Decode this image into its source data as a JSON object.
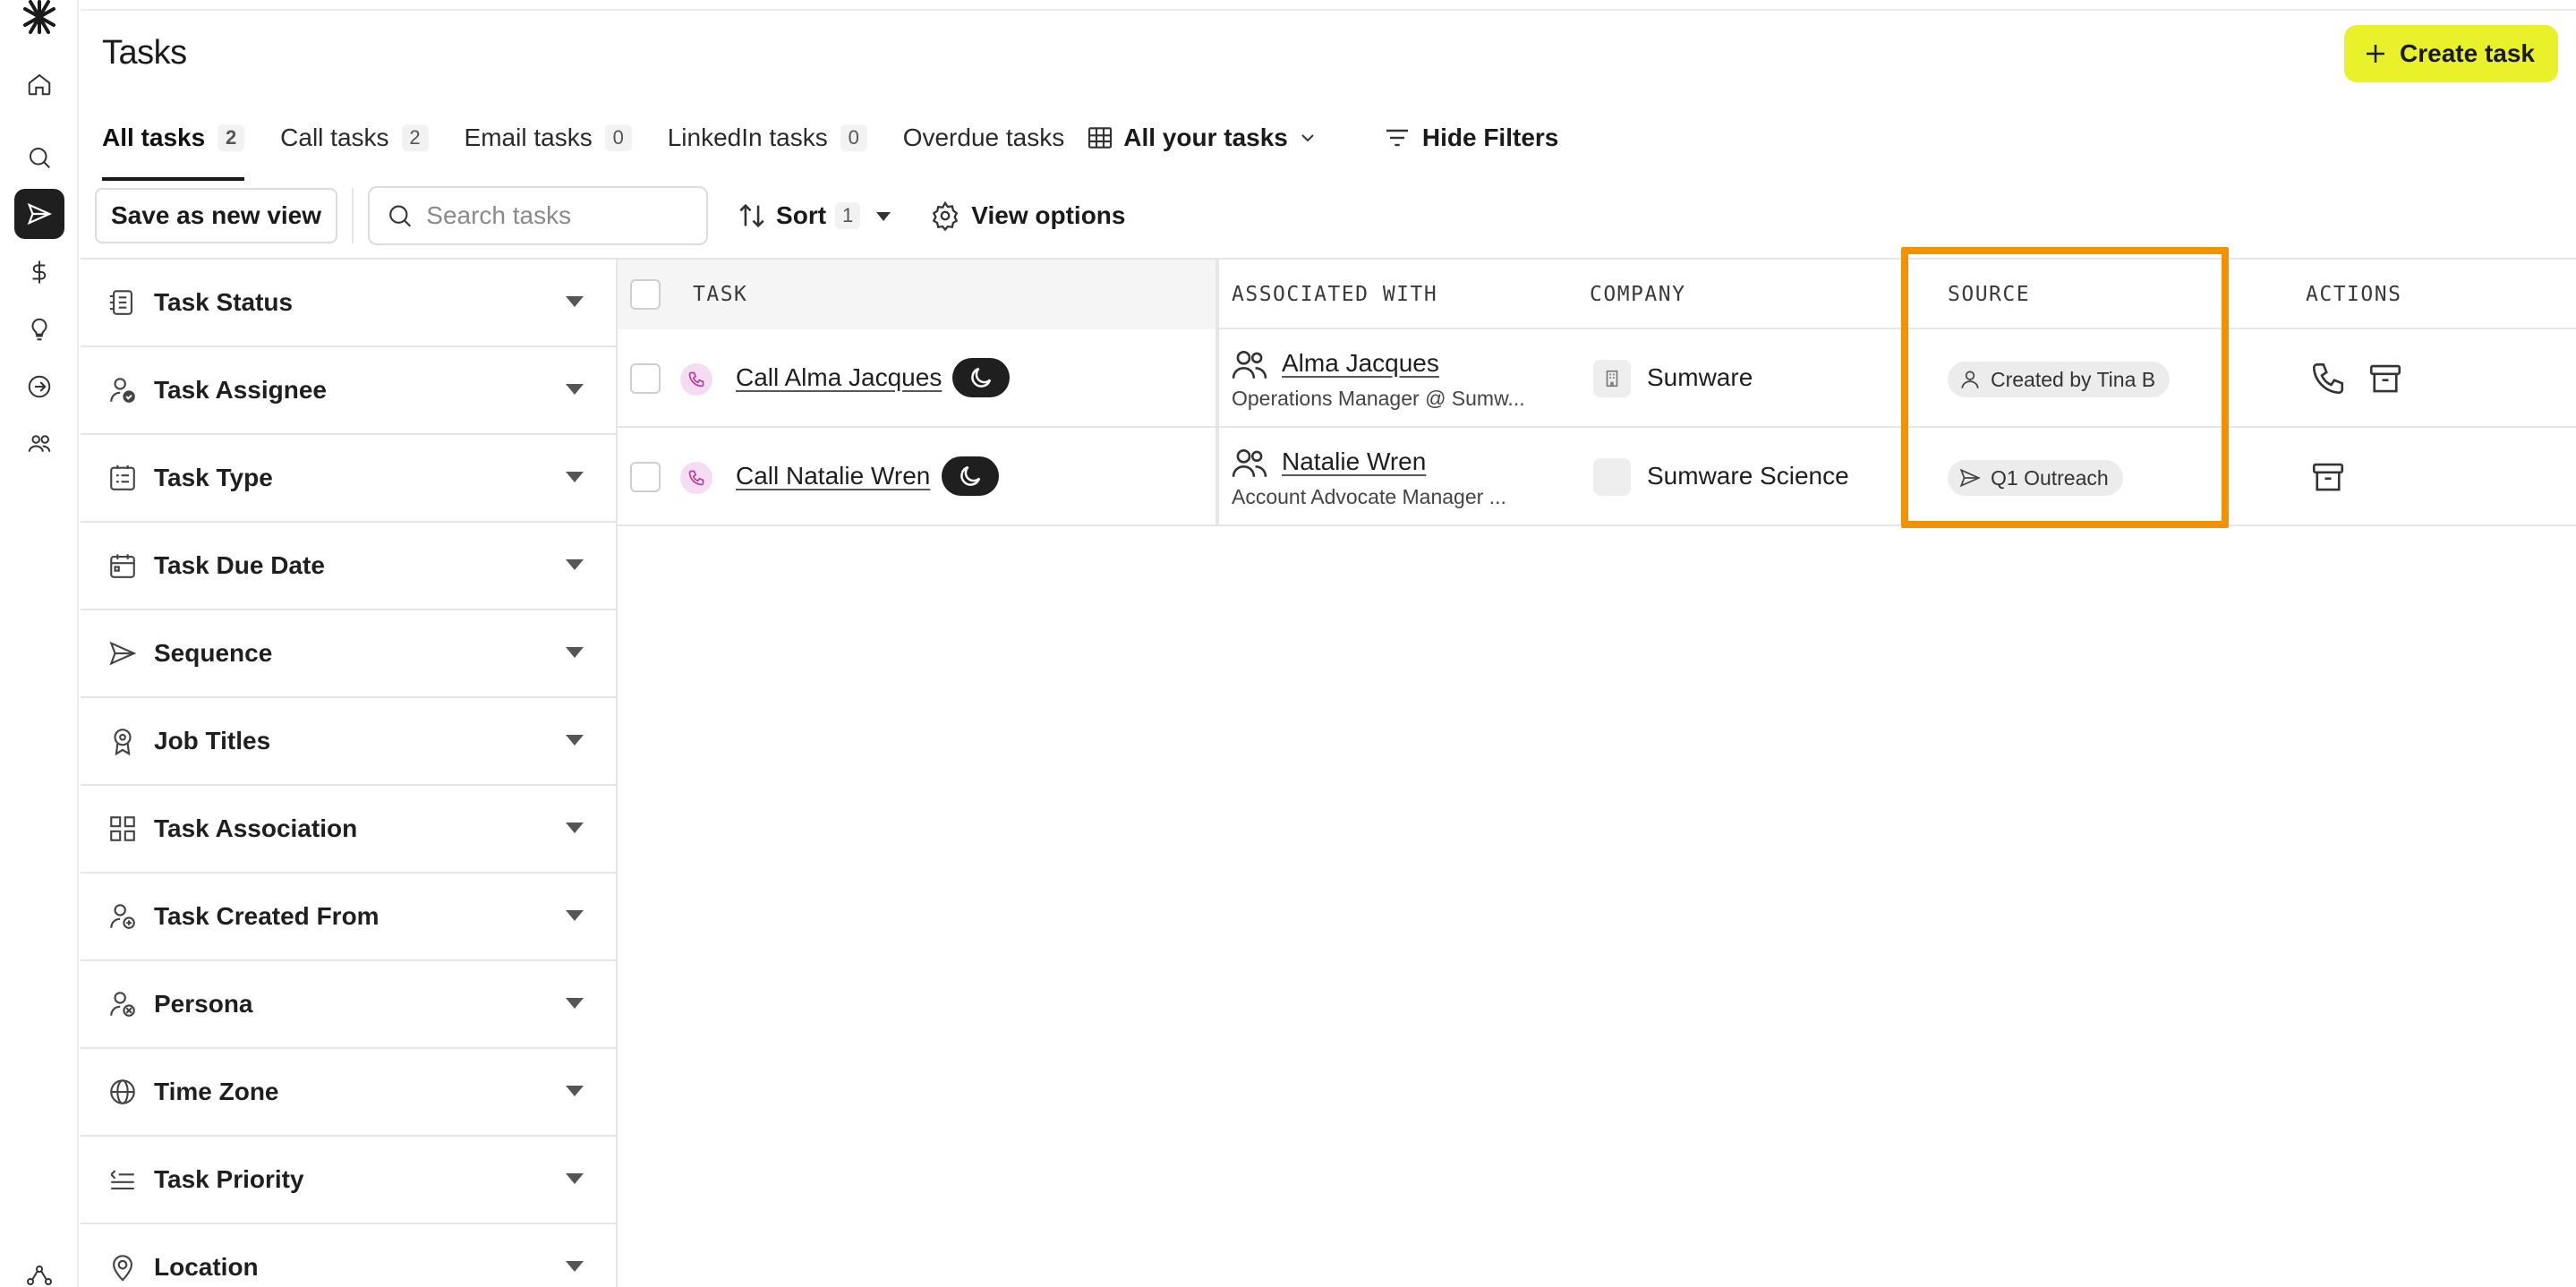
{
  "page": {
    "title": "Tasks"
  },
  "header": {
    "create_label": "Create task"
  },
  "tabs": [
    {
      "label": "All tasks",
      "count": "2",
      "active": true
    },
    {
      "label": "Call tasks",
      "count": "2"
    },
    {
      "label": "Email tasks",
      "count": "0"
    },
    {
      "label": "LinkedIn tasks",
      "count": "0"
    },
    {
      "label": "Overdue tasks",
      "count": ""
    }
  ],
  "view_select": {
    "label": "All your tasks"
  },
  "hide_filters": {
    "label": "Hide Filters"
  },
  "toolbar": {
    "save_view_label": "Save as new view",
    "search_placeholder": "Search tasks",
    "sort_label": "Sort",
    "sort_count": "1",
    "view_options_label": "View options"
  },
  "filters": [
    {
      "label": "Task Status",
      "icon": "status-icon"
    },
    {
      "label": "Task Assignee",
      "icon": "user-check-icon"
    },
    {
      "label": "Task Type",
      "icon": "list-icon"
    },
    {
      "label": "Task Due Date",
      "icon": "calendar-icon"
    },
    {
      "label": "Sequence",
      "icon": "send-icon"
    },
    {
      "label": "Job Titles",
      "icon": "badge-icon"
    },
    {
      "label": "Task Association",
      "icon": "grid-icon"
    },
    {
      "label": "Task Created From",
      "icon": "user-plus-icon"
    },
    {
      "label": "Persona",
      "icon": "user-x-icon"
    },
    {
      "label": "Time Zone",
      "icon": "globe-icon"
    },
    {
      "label": "Task Priority",
      "icon": "priority-icon"
    },
    {
      "label": "Location",
      "icon": "location-icon"
    }
  ],
  "table": {
    "headers": {
      "task": "TASK",
      "associated": "ASSOCIATED WITH",
      "company": "COMPANY",
      "source": "SOURCE",
      "actions": "ACTIONS"
    },
    "rows": [
      {
        "task": "Call Alma Jacques",
        "assoc_name": "Alma Jacques",
        "assoc_sub": "Operations Manager @ Sumw...",
        "company": "Sumware",
        "source": "Created by Tina B",
        "source_icon": "user-icon"
      },
      {
        "task": "Call Natalie Wren",
        "assoc_name": "Natalie Wren",
        "assoc_sub": "Account Advocate Manager ...",
        "company": "Sumware Science",
        "source": "Q1 Outreach",
        "source_icon": "send-icon"
      }
    ]
  },
  "colors": {
    "accent_button": "#e8f12a",
    "highlight": "#f39200",
    "call_dot": "#f6dcf2"
  }
}
